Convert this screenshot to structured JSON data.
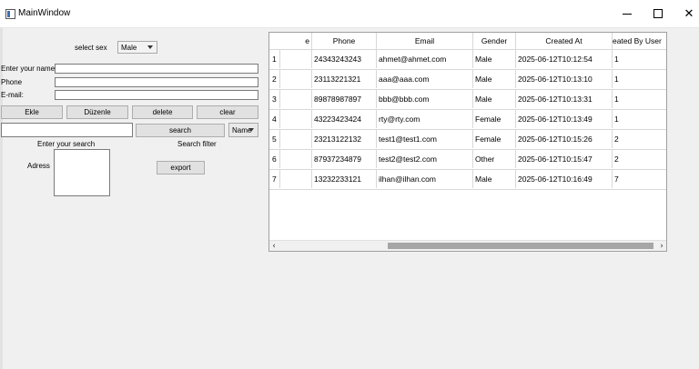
{
  "window": {
    "title": "MainWindow"
  },
  "form": {
    "sex_label": "select sex",
    "sex_value": "Male",
    "name_label": "Enter your name",
    "phone_label": "Phone",
    "email_label": "E-mail:",
    "name_value": "",
    "phone_value": "",
    "email_value": "",
    "buttons": {
      "ekle": "Ekle",
      "duzenle": "Düzenle",
      "delete": "delete",
      "clear": "clear"
    },
    "search_value": "",
    "search_button": "search",
    "filter_value": "Name",
    "enter_search_label": "Enter your search",
    "search_filter_label": "Search filter",
    "adress_label": "Adress",
    "adress_value": "",
    "export_button": "export"
  },
  "table": {
    "headers": [
      "e",
      "Phone",
      "Email",
      "Gender",
      "Created At",
      "eated By User"
    ],
    "rows": [
      {
        "row_num": "1",
        "cells": [
          "",
          "24343243243",
          "ahmet@ahmet.com",
          "Male",
          "2025-06-12T10:12:54",
          "1"
        ]
      },
      {
        "row_num": "2",
        "cells": [
          "",
          "23113221321",
          "aaa@aaa.com",
          "Male",
          "2025-06-12T10:13:10",
          "1"
        ]
      },
      {
        "row_num": "3",
        "cells": [
          "",
          "89878987897",
          "bbb@bbb.com",
          "Male",
          "2025-06-12T10:13:31",
          "1"
        ]
      },
      {
        "row_num": "4",
        "cells": [
          "",
          "43223423424",
          "rty@rty.com",
          "Female",
          "2025-06-12T10:13:49",
          "1"
        ]
      },
      {
        "row_num": "5",
        "cells": [
          "",
          "23213122132",
          "test1@test1.com",
          "Female",
          "2025-06-12T10:15:26",
          "2"
        ]
      },
      {
        "row_num": "6",
        "cells": [
          "",
          "87937234879",
          "test2@test2.com",
          "Other",
          "2025-06-12T10:15:47",
          "2"
        ]
      },
      {
        "row_num": "7",
        "cells": [
          "",
          "13232233121",
          "ilhan@ilhan.com",
          "Male",
          "2025-06-12T10:16:49",
          "7"
        ]
      }
    ]
  }
}
